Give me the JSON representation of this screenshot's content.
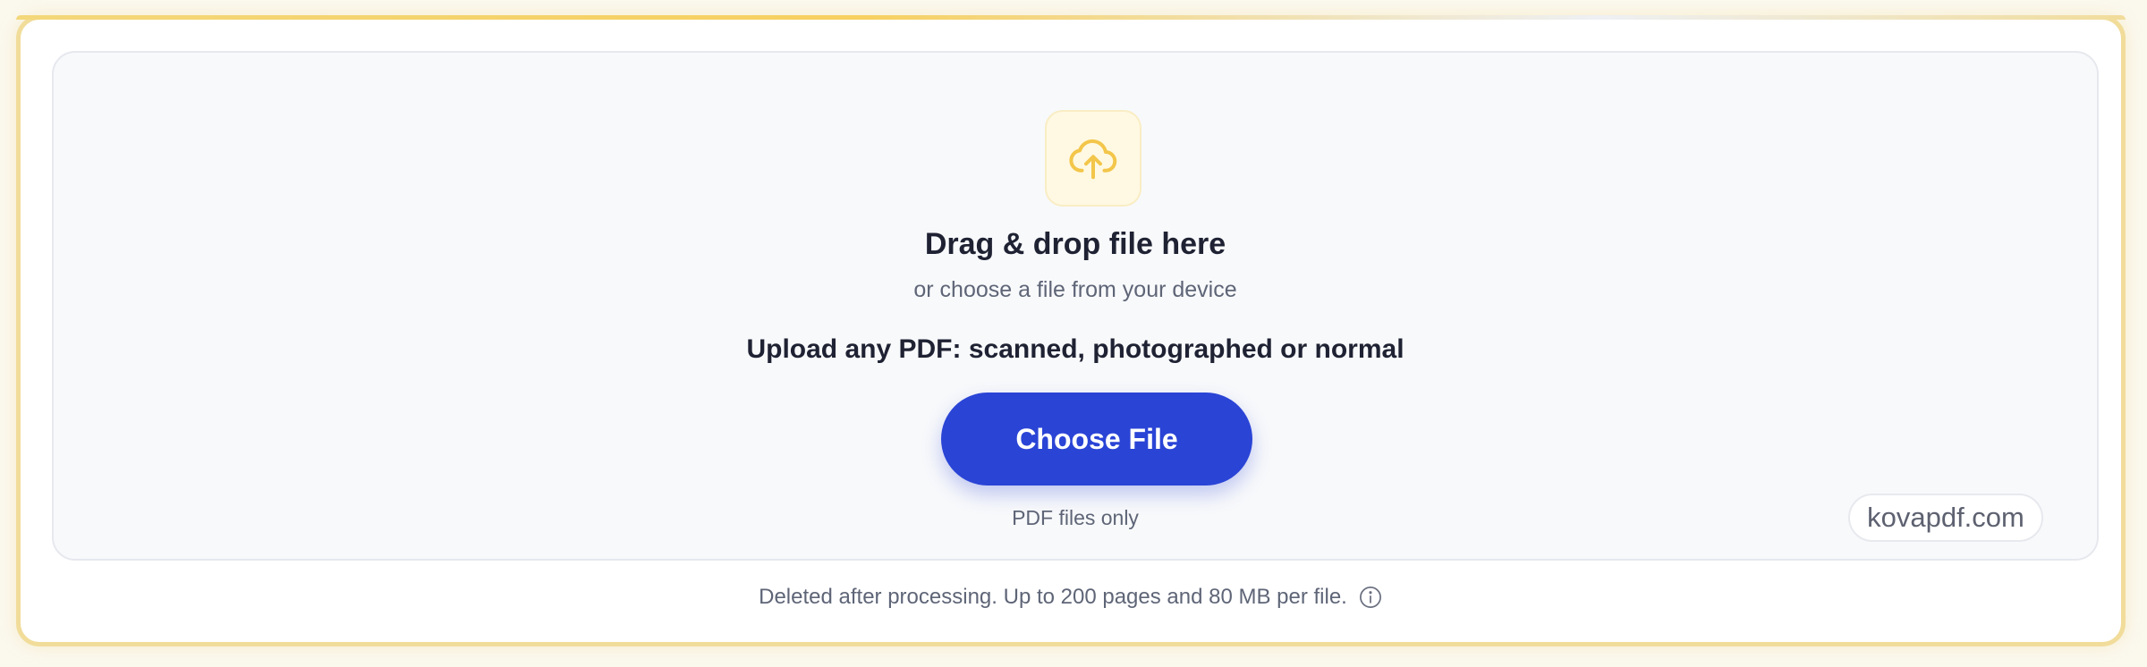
{
  "dropzone": {
    "icon": "cloud-upload-icon",
    "title": "Drag & drop file here",
    "subtitle": "or choose a file from your device",
    "hint": "Upload any PDF: scanned, photographed or normal",
    "button_label": "Choose File",
    "file_types_note": "PDF files only",
    "watermark": "kovapdf.com"
  },
  "footer": {
    "note": "Deleted after processing. Up to 200 pages and 80 MB per file.",
    "info_icon": "info-icon"
  },
  "colors": {
    "accent": "#2a44d6",
    "icon_yellow": "#f3c64a",
    "border_gold": "#f1dc9a"
  }
}
